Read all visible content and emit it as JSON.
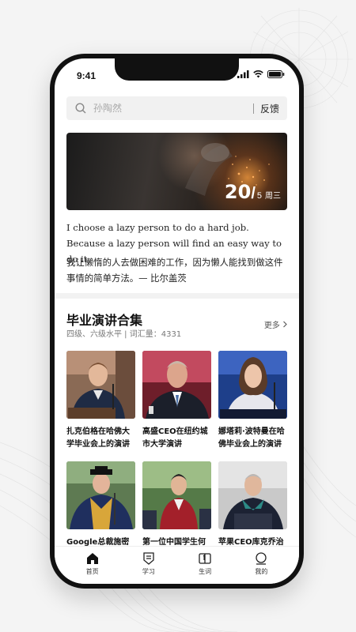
{
  "status": {
    "time": "9:41"
  },
  "search": {
    "placeholder": "孙陶然",
    "feedback_label": "反馈"
  },
  "banner": {
    "day": "20",
    "month": "5",
    "weekday": "周三"
  },
  "quote": {
    "english": "I choose a lazy person to do a hard job. Because a lazy person will find an easy way to do it.",
    "chinese": "我让懒惰的人去做困难的工作，因为懒人能找到做这件事情的简单方法。— 比尔盖茨"
  },
  "section": {
    "title": "毕业演讲合集",
    "subtitle": "四级、六级水平 | 词汇量：4331",
    "more_label": "更多"
  },
  "cards": [
    {
      "caption": "扎克伯格在哈佛大学毕业会上的演讲"
    },
    {
      "caption": "高盛CEO在纽约城市大学演讲"
    },
    {
      "caption": "娜塔莉·波特曼在哈佛毕业会上的演讲"
    },
    {
      "caption": "Google总裁施密特"
    },
    {
      "caption": "第一位中国学生何"
    },
    {
      "caption": "苹果CEO库克乔治"
    }
  ],
  "tabs": [
    {
      "label": "首页",
      "icon": "home-icon"
    },
    {
      "label": "学习",
      "icon": "study-icon"
    },
    {
      "label": "生词",
      "icon": "vocab-book-icon"
    },
    {
      "label": "我的",
      "icon": "profile-icon"
    }
  ]
}
